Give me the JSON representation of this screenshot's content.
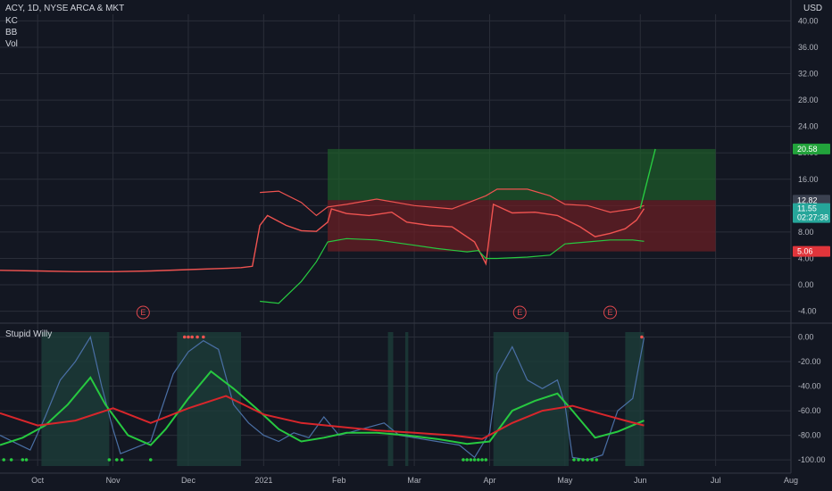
{
  "header": {
    "symbol": "ACY, 1D, NYSE ARCA & MKT",
    "ind1": "KC",
    "ind2": "BB",
    "ind3": "Vol",
    "currency": "USD"
  },
  "sub_title": "Stupid Willy",
  "colors": {
    "background": "#131722",
    "candle_up": "#26a69a",
    "candle_down": "#ef5350",
    "green_line": "#27c940",
    "red_line": "#d8262b",
    "blue_line": "#4a6fa5",
    "profit_zone": "#1e5e2a",
    "loss_zone": "#6e1f24",
    "grid": "#2a2e39"
  },
  "price_tags": [
    {
      "label": "20.58",
      "color": "#22a33b",
      "value": 20.58
    },
    {
      "label": "12.82",
      "color": "#3b4150",
      "value": 12.82
    },
    {
      "label": "11.55",
      "color": "#26a69a",
      "value": 11.55
    },
    {
      "label": "02:27:38",
      "color": "#26a69a",
      "value": 10.2
    },
    {
      "label": "5.06",
      "color": "#e0353b",
      "value": 5.06
    }
  ],
  "earnings_markers": [
    "E",
    "E",
    "E"
  ],
  "chart_data": [
    {
      "type": "line",
      "title": "",
      "y_ticks": [
        -4,
        0,
        4,
        8,
        12,
        16,
        20,
        24,
        28,
        32,
        36,
        40
      ],
      "y_tick_labels": [
        "-4.00",
        "0.00",
        "4.00",
        "8.00",
        "12.00",
        "16.00",
        "20.00",
        "24.00",
        "28.00",
        "32.00",
        "36.00",
        "40.00"
      ],
      "ylim": [
        -5,
        41
      ],
      "x_tick_labels": [
        "Oct",
        "Nov",
        "Dec",
        "2021",
        "Feb",
        "Mar",
        "Apr",
        "May",
        "Jun",
        "Jul",
        "Aug"
      ],
      "x_tick_positions": [
        0.5,
        1.5,
        2.5,
        3.5,
        4.5,
        5.5,
        6.5,
        7.5,
        8.5,
        9.5,
        10.5
      ],
      "xlim": [
        0,
        10.5
      ],
      "grid": true,
      "series": [
        {
          "name": "",
          "values": [
            [
              0,
              2.2
            ],
            [
              0.5,
              2.1
            ],
            [
              1,
              2.0
            ],
            [
              1.5,
              2.0
            ],
            [
              2,
              2.1
            ],
            [
              2.5,
              2.3
            ],
            [
              3,
              2.5
            ],
            [
              3.2,
              2.6
            ],
            [
              3.35,
              2.8
            ],
            [
              3.45,
              9.0
            ],
            [
              3.55,
              10.5
            ],
            [
              3.8,
              9.0
            ],
            [
              4.0,
              8.2
            ],
            [
              4.2,
              8.1
            ],
            [
              4.35,
              9.5
            ],
            [
              4.4,
              11.5
            ],
            [
              4.6,
              10.8
            ],
            [
              4.9,
              10.5
            ],
            [
              5.2,
              11.0
            ],
            [
              5.4,
              9.5
            ],
            [
              5.7,
              9.0
            ],
            [
              6.0,
              8.8
            ],
            [
              6.3,
              6.5
            ],
            [
              6.45,
              3.2
            ],
            [
              6.55,
              12.2
            ],
            [
              6.8,
              10.9
            ],
            [
              7.1,
              11.0
            ],
            [
              7.4,
              10.5
            ],
            [
              7.7,
              8.8
            ],
            [
              7.9,
              7.3
            ],
            [
              8.1,
              7.8
            ],
            [
              8.3,
              8.5
            ],
            [
              8.45,
              9.8
            ],
            [
              8.55,
              11.55
            ]
          ]
        },
        {
          "name": "",
          "values": [
            [
              3.45,
              -2.5
            ],
            [
              3.7,
              -2.8
            ],
            [
              4.0,
              0.5
            ],
            [
              4.2,
              3.5
            ],
            [
              4.35,
              6.5
            ],
            [
              4.6,
              7.0
            ],
            [
              5.0,
              6.8
            ],
            [
              5.5,
              6.0
            ],
            [
              5.8,
              5.5
            ],
            [
              6.2,
              5.0
            ],
            [
              6.35,
              5.2
            ],
            [
              6.45,
              4.0
            ],
            [
              6.6,
              4.0
            ],
            [
              7.0,
              4.2
            ],
            [
              7.3,
              4.5
            ],
            [
              7.5,
              6.2
            ],
            [
              7.8,
              6.5
            ],
            [
              8.1,
              6.8
            ],
            [
              8.4,
              6.8
            ],
            [
              8.55,
              6.6
            ]
          ]
        },
        {
          "name": "",
          "values": [
            [
              3.45,
              14.0
            ],
            [
              3.7,
              14.2
            ],
            [
              4.0,
              12.5
            ],
            [
              4.2,
              10.5
            ],
            [
              4.35,
              11.8
            ],
            [
              4.6,
              12.2
            ],
            [
              5.0,
              13.0
            ],
            [
              5.5,
              12.0
            ],
            [
              6.0,
              11.5
            ],
            [
              6.45,
              13.5
            ],
            [
              6.6,
              14.5
            ],
            [
              7.0,
              14.5
            ],
            [
              7.3,
              13.5
            ],
            [
              7.5,
              12.2
            ],
            [
              7.8,
              12.0
            ],
            [
              8.1,
              11.0
            ],
            [
              8.4,
              11.5
            ],
            [
              8.55,
              12.0
            ]
          ]
        }
      ],
      "zones": {
        "x_start": 4.35,
        "x_end": 9.5,
        "entry": 12.82,
        "target": 20.58,
        "stop": 5.06
      },
      "projection": [
        [
          8.5,
          11.55
        ],
        [
          8.7,
          20.58
        ]
      ],
      "earnings_x": [
        1.9,
        6.9,
        8.1
      ]
    },
    {
      "type": "line",
      "title": "Stupid Willy",
      "y_ticks": [
        0,
        -20,
        -40,
        -60,
        -80,
        -100
      ],
      "y_tick_labels": [
        "0.00",
        "-20.00",
        "-40.00",
        "-60.00",
        "-80.00",
        "-100.00"
      ],
      "ylim": [
        -105,
        4
      ],
      "xlim": [
        0,
        10.5
      ],
      "series": [
        {
          "name": "",
          "values": [
            [
              0,
              -80
            ],
            [
              0.2,
              -86
            ],
            [
              0.4,
              -92
            ],
            [
              0.6,
              -65
            ],
            [
              0.8,
              -35
            ],
            [
              1.0,
              -20
            ],
            [
              1.2,
              0
            ],
            [
              1.35,
              -40
            ],
            [
              1.5,
              -75
            ],
            [
              1.6,
              -95
            ],
            [
              1.8,
              -90
            ],
            [
              2.0,
              -85
            ],
            [
              2.3,
              -30
            ],
            [
              2.5,
              -12
            ],
            [
              2.7,
              -3
            ],
            [
              2.9,
              -10
            ],
            [
              3.1,
              -55
            ],
            [
              3.3,
              -70
            ],
            [
              3.5,
              -80
            ],
            [
              3.7,
              -85
            ],
            [
              3.9,
              -78
            ],
            [
              4.1,
              -82
            ],
            [
              4.3,
              -65
            ],
            [
              4.5,
              -80
            ],
            [
              4.8,
              -75
            ],
            [
              5.1,
              -70
            ],
            [
              5.3,
              -80
            ],
            [
              5.5,
              -82
            ],
            [
              5.8,
              -85
            ],
            [
              6.1,
              -88
            ],
            [
              6.3,
              -98
            ],
            [
              6.5,
              -78
            ],
            [
              6.6,
              -30
            ],
            [
              6.8,
              -8
            ],
            [
              7.0,
              -35
            ],
            [
              7.2,
              -42
            ],
            [
              7.4,
              -35
            ],
            [
              7.5,
              -55
            ],
            [
              7.6,
              -98
            ],
            [
              7.8,
              -100
            ],
            [
              8.0,
              -96
            ],
            [
              8.2,
              -60
            ],
            [
              8.4,
              -50
            ],
            [
              8.55,
              -0.5
            ]
          ]
        },
        {
          "name": "",
          "values": [
            [
              0,
              -88
            ],
            [
              0.3,
              -82
            ],
            [
              0.6,
              -72
            ],
            [
              0.9,
              -55
            ],
            [
              1.2,
              -33
            ],
            [
              1.4,
              -55
            ],
            [
              1.7,
              -80
            ],
            [
              2.0,
              -88
            ],
            [
              2.2,
              -75
            ],
            [
              2.5,
              -50
            ],
            [
              2.8,
              -28
            ],
            [
              3.1,
              -42
            ],
            [
              3.4,
              -58
            ],
            [
              3.7,
              -75
            ],
            [
              4.0,
              -85
            ],
            [
              4.3,
              -82
            ],
            [
              4.6,
              -78
            ],
            [
              5.0,
              -78
            ],
            [
              5.4,
              -80
            ],
            [
              5.8,
              -83
            ],
            [
              6.2,
              -87
            ],
            [
              6.5,
              -85
            ],
            [
              6.8,
              -60
            ],
            [
              7.1,
              -52
            ],
            [
              7.4,
              -46
            ],
            [
              7.6,
              -60
            ],
            [
              7.9,
              -82
            ],
            [
              8.2,
              -77
            ],
            [
              8.55,
              -68
            ]
          ]
        },
        {
          "name": "",
          "values": [
            [
              0,
              -62
            ],
            [
              0.5,
              -72
            ],
            [
              1.0,
              -68
            ],
            [
              1.5,
              -58
            ],
            [
              2.0,
              -70
            ],
            [
              2.5,
              -58
            ],
            [
              3.0,
              -48
            ],
            [
              3.5,
              -63
            ],
            [
              4.0,
              -70
            ],
            [
              4.5,
              -73
            ],
            [
              5.0,
              -76
            ],
            [
              5.5,
              -78
            ],
            [
              6.0,
              -80
            ],
            [
              6.4,
              -83
            ],
            [
              6.8,
              -70
            ],
            [
              7.2,
              -60
            ],
            [
              7.6,
              -56
            ],
            [
              8.0,
              -63
            ],
            [
              8.3,
              -68
            ],
            [
              8.55,
              -72
            ]
          ]
        }
      ],
      "highlight_ranges": [
        [
          0.55,
          1.45
        ],
        [
          2.35,
          3.2
        ],
        [
          5.15,
          5.22
        ],
        [
          5.38,
          5.42
        ],
        [
          6.55,
          7.55
        ],
        [
          8.3,
          8.55
        ]
      ],
      "bottom_dots": [
        0.05,
        0.15,
        0.3,
        0.35,
        1.45,
        1.55,
        1.62,
        2.0,
        6.15,
        6.2,
        6.25,
        6.3,
        6.35,
        6.4,
        6.45,
        7.62,
        7.68,
        7.74,
        7.8,
        7.86,
        7.92
      ],
      "top_dots": [
        2.45,
        2.5,
        2.55,
        2.62,
        2.7,
        8.52
      ]
    }
  ]
}
